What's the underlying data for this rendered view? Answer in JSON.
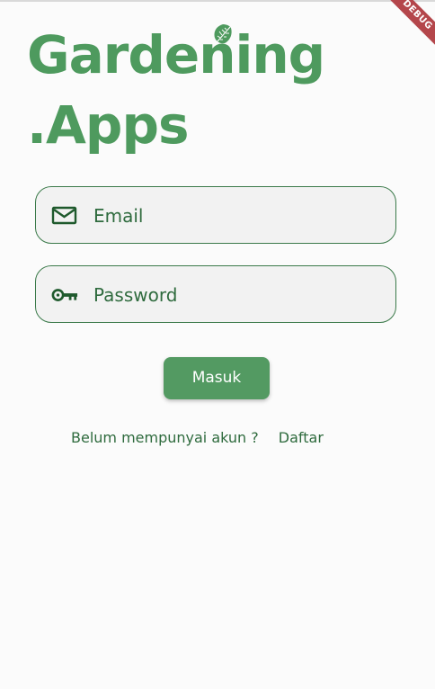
{
  "debug_banner": "DEBUG",
  "logo": {
    "line1": "Gardening",
    "line2": ".Apps",
    "color": "#4e9a5e",
    "accent_icon": "leaf-icon"
  },
  "email": {
    "placeholder": "Email",
    "icon": "mail-icon"
  },
  "password": {
    "placeholder": "Password",
    "icon": "key-icon"
  },
  "submit": {
    "label": "Masuk",
    "color": "#539a62"
  },
  "register": {
    "prompt": "Belum mempunyai akun ?",
    "link": "Daftar"
  },
  "colors": {
    "primary": "#539a62",
    "text": "#2f6b3e",
    "border": "#3b7a4a",
    "field_bg": "#f2f2f2",
    "background": "#fbfbfb",
    "debug_banner": "#b4464b"
  }
}
